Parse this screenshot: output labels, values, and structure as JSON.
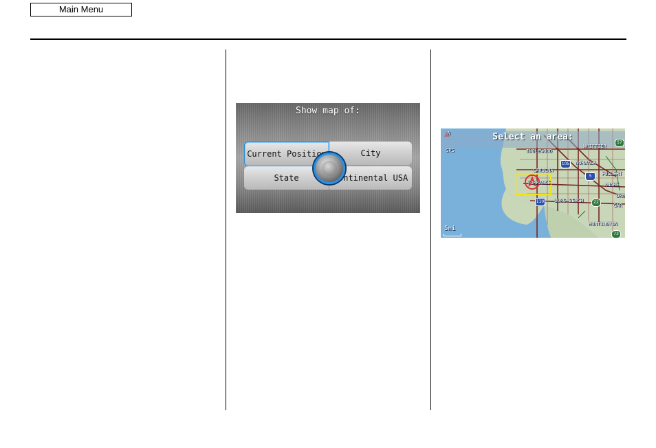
{
  "header": {
    "main_menu_label": "Main Menu"
  },
  "show_map_screen": {
    "title": "Show map of:",
    "options": [
      "Current Position",
      "City",
      "State",
      "Continental USA"
    ]
  },
  "area_map_screen": {
    "title": "Select an area:",
    "compass": {
      "north": "N"
    },
    "gps_label": "GPS",
    "scale_label": "5mi",
    "places": [
      "INGLEWOOD",
      "WHITTIER",
      "NORWALK",
      "GARDENA",
      "FULLERT",
      "ANAHE",
      "TORRANCE",
      "LONG BEACH",
      "GAR",
      "ORA",
      "HUNTINGTON"
    ],
    "routes": [
      "57",
      "105",
      "5",
      "110",
      "22",
      "73"
    ],
    "colors": {
      "water": "#7ab1da",
      "land": "#c9d7b9",
      "highway": "#7a2424",
      "cursor_box": "#f2e21a"
    }
  }
}
